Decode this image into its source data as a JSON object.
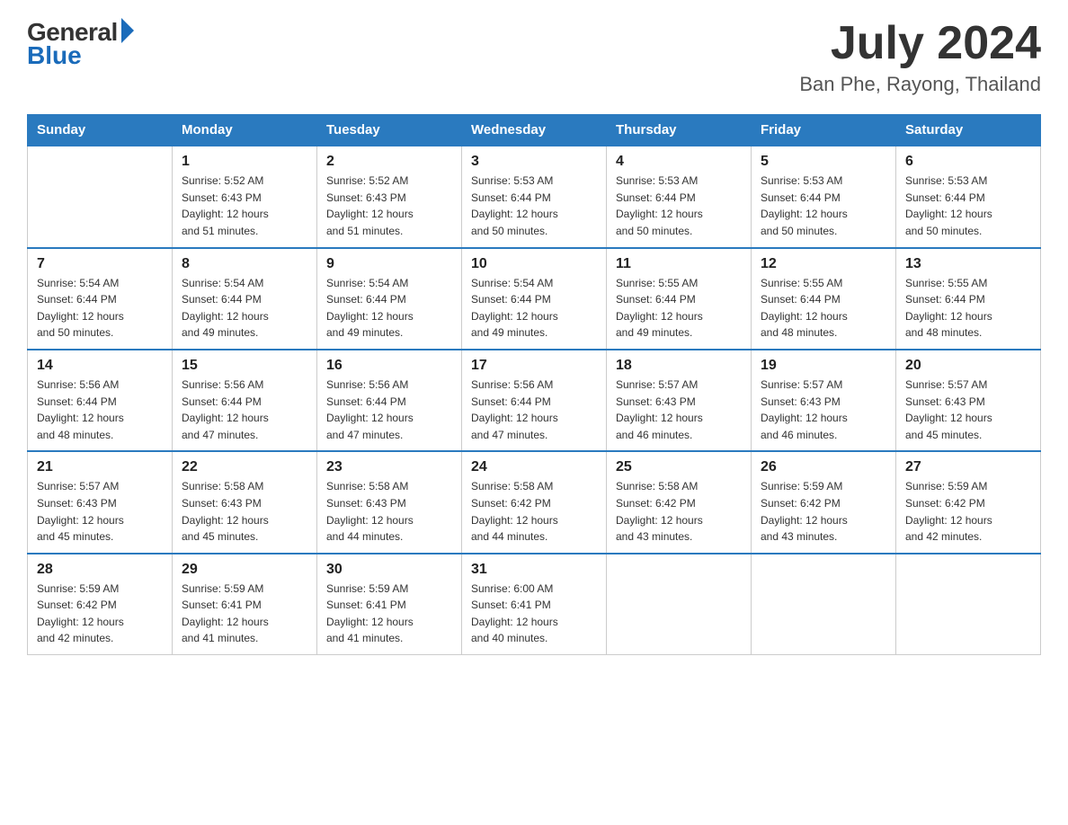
{
  "logo": {
    "general": "General",
    "blue": "Blue"
  },
  "title": "July 2024",
  "location": "Ban Phe, Rayong, Thailand",
  "weekdays": [
    "Sunday",
    "Monday",
    "Tuesday",
    "Wednesday",
    "Thursday",
    "Friday",
    "Saturday"
  ],
  "weeks": [
    [
      {
        "day": "",
        "info": ""
      },
      {
        "day": "1",
        "info": "Sunrise: 5:52 AM\nSunset: 6:43 PM\nDaylight: 12 hours\nand 51 minutes."
      },
      {
        "day": "2",
        "info": "Sunrise: 5:52 AM\nSunset: 6:43 PM\nDaylight: 12 hours\nand 51 minutes."
      },
      {
        "day": "3",
        "info": "Sunrise: 5:53 AM\nSunset: 6:44 PM\nDaylight: 12 hours\nand 50 minutes."
      },
      {
        "day": "4",
        "info": "Sunrise: 5:53 AM\nSunset: 6:44 PM\nDaylight: 12 hours\nand 50 minutes."
      },
      {
        "day": "5",
        "info": "Sunrise: 5:53 AM\nSunset: 6:44 PM\nDaylight: 12 hours\nand 50 minutes."
      },
      {
        "day": "6",
        "info": "Sunrise: 5:53 AM\nSunset: 6:44 PM\nDaylight: 12 hours\nand 50 minutes."
      }
    ],
    [
      {
        "day": "7",
        "info": "Sunrise: 5:54 AM\nSunset: 6:44 PM\nDaylight: 12 hours\nand 50 minutes."
      },
      {
        "day": "8",
        "info": "Sunrise: 5:54 AM\nSunset: 6:44 PM\nDaylight: 12 hours\nand 49 minutes."
      },
      {
        "day": "9",
        "info": "Sunrise: 5:54 AM\nSunset: 6:44 PM\nDaylight: 12 hours\nand 49 minutes."
      },
      {
        "day": "10",
        "info": "Sunrise: 5:54 AM\nSunset: 6:44 PM\nDaylight: 12 hours\nand 49 minutes."
      },
      {
        "day": "11",
        "info": "Sunrise: 5:55 AM\nSunset: 6:44 PM\nDaylight: 12 hours\nand 49 minutes."
      },
      {
        "day": "12",
        "info": "Sunrise: 5:55 AM\nSunset: 6:44 PM\nDaylight: 12 hours\nand 48 minutes."
      },
      {
        "day": "13",
        "info": "Sunrise: 5:55 AM\nSunset: 6:44 PM\nDaylight: 12 hours\nand 48 minutes."
      }
    ],
    [
      {
        "day": "14",
        "info": "Sunrise: 5:56 AM\nSunset: 6:44 PM\nDaylight: 12 hours\nand 48 minutes."
      },
      {
        "day": "15",
        "info": "Sunrise: 5:56 AM\nSunset: 6:44 PM\nDaylight: 12 hours\nand 47 minutes."
      },
      {
        "day": "16",
        "info": "Sunrise: 5:56 AM\nSunset: 6:44 PM\nDaylight: 12 hours\nand 47 minutes."
      },
      {
        "day": "17",
        "info": "Sunrise: 5:56 AM\nSunset: 6:44 PM\nDaylight: 12 hours\nand 47 minutes."
      },
      {
        "day": "18",
        "info": "Sunrise: 5:57 AM\nSunset: 6:43 PM\nDaylight: 12 hours\nand 46 minutes."
      },
      {
        "day": "19",
        "info": "Sunrise: 5:57 AM\nSunset: 6:43 PM\nDaylight: 12 hours\nand 46 minutes."
      },
      {
        "day": "20",
        "info": "Sunrise: 5:57 AM\nSunset: 6:43 PM\nDaylight: 12 hours\nand 45 minutes."
      }
    ],
    [
      {
        "day": "21",
        "info": "Sunrise: 5:57 AM\nSunset: 6:43 PM\nDaylight: 12 hours\nand 45 minutes."
      },
      {
        "day": "22",
        "info": "Sunrise: 5:58 AM\nSunset: 6:43 PM\nDaylight: 12 hours\nand 45 minutes."
      },
      {
        "day": "23",
        "info": "Sunrise: 5:58 AM\nSunset: 6:43 PM\nDaylight: 12 hours\nand 44 minutes."
      },
      {
        "day": "24",
        "info": "Sunrise: 5:58 AM\nSunset: 6:42 PM\nDaylight: 12 hours\nand 44 minutes."
      },
      {
        "day": "25",
        "info": "Sunrise: 5:58 AM\nSunset: 6:42 PM\nDaylight: 12 hours\nand 43 minutes."
      },
      {
        "day": "26",
        "info": "Sunrise: 5:59 AM\nSunset: 6:42 PM\nDaylight: 12 hours\nand 43 minutes."
      },
      {
        "day": "27",
        "info": "Sunrise: 5:59 AM\nSunset: 6:42 PM\nDaylight: 12 hours\nand 42 minutes."
      }
    ],
    [
      {
        "day": "28",
        "info": "Sunrise: 5:59 AM\nSunset: 6:42 PM\nDaylight: 12 hours\nand 42 minutes."
      },
      {
        "day": "29",
        "info": "Sunrise: 5:59 AM\nSunset: 6:41 PM\nDaylight: 12 hours\nand 41 minutes."
      },
      {
        "day": "30",
        "info": "Sunrise: 5:59 AM\nSunset: 6:41 PM\nDaylight: 12 hours\nand 41 minutes."
      },
      {
        "day": "31",
        "info": "Sunrise: 6:00 AM\nSunset: 6:41 PM\nDaylight: 12 hours\nand 40 minutes."
      },
      {
        "day": "",
        "info": ""
      },
      {
        "day": "",
        "info": ""
      },
      {
        "day": "",
        "info": ""
      }
    ]
  ]
}
